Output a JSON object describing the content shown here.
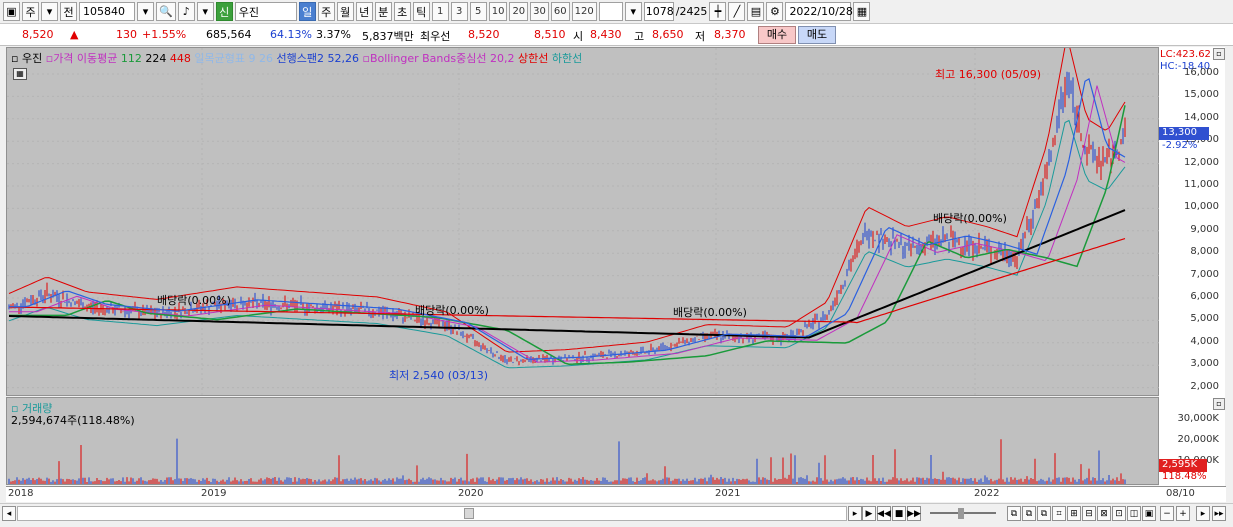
{
  "toolbar": {
    "type1": "주",
    "type2": "전",
    "code": "105840",
    "badge": "신",
    "name": "우진",
    "periods": [
      "일",
      "주",
      "월",
      "년",
      "분",
      "초",
      "틱"
    ],
    "minutes": [
      "1",
      "3",
      "5",
      "10",
      "20",
      "30",
      "60",
      "120"
    ],
    "count": "1078",
    "total": "/2425",
    "date": "2022/10/28"
  },
  "quote": {
    "price": "8,520",
    "arrow": "▲",
    "change": "130",
    "rate": "+1.55%",
    "volume": "685,564",
    "ratio": "64.13%",
    "turnover": "3.37%",
    "amount": "5,837백만",
    "bid_label": "최우선",
    "bid1": "8,520",
    "bid2": "8,510",
    "open_l": "시",
    "open": "8,430",
    "high_l": "고",
    "high": "8,650",
    "low_l": "저",
    "low": "8,370",
    "buy": "매수",
    "sell": "매도"
  },
  "legend": {
    "name": "우진",
    "ma": "가격 이동평균",
    "ma1": "112",
    "ma2": "224",
    "ma3": "448",
    "cloud_faded": "일목균형표 9 26",
    "span2": "선행스팬2 52,26",
    "bb": "Bollinger Bands중심선 20,2",
    "upper": "상한선",
    "lower": "하한선"
  },
  "annotations": {
    "high": "최고 16,300 (05/09)",
    "low": "최저 2,540 (03/13)",
    "div1": "배당락(0.00%)",
    "div2": "배당락(0.00%)",
    "div3": "배당락(0.00%)",
    "div4": "배당락(0.00%)"
  },
  "right_axis": {
    "lc": "LC:423.62",
    "hc": "HC:-18.40",
    "ticks": [
      "16,000",
      "15,000",
      "14,000",
      "13,000",
      "12,000",
      "11,000",
      "10,000",
      "9,000",
      "8,000",
      "7,000",
      "6,000",
      "5,000",
      "4,000",
      "3,000",
      "2,000"
    ],
    "current": "13,300",
    "current_rate": "-2.92%"
  },
  "volume": {
    "title": "거래량",
    "value": "2,594,674주(118.48%)",
    "ticks": [
      "30,000K",
      "20,000K",
      "10,000K"
    ],
    "current": "2,595K",
    "current_rate": "118.48%"
  },
  "x_axis": {
    "labels": [
      "2018",
      "2019",
      "2020",
      "2021",
      "2022"
    ],
    "right": "08/10"
  },
  "colors": {
    "up": "#e00000",
    "down": "#1a3fd0",
    "ma112": "#1a9a3a",
    "ma224": "#000000",
    "ma448": "#e00000",
    "cloud": "#5aaaf0",
    "bb": "#c030c0"
  }
}
